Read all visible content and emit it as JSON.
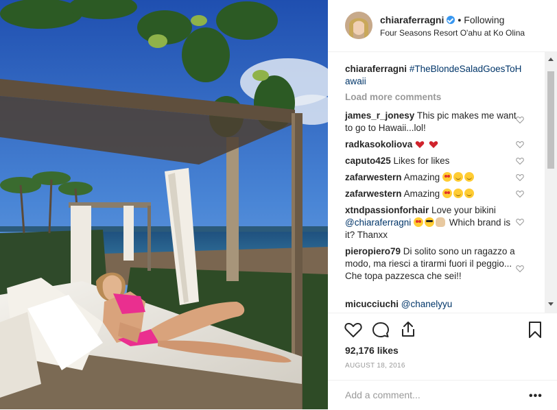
{
  "post": {
    "username": "chiaraferragni",
    "follow_status": "Following",
    "separator": "•",
    "location": "Four Seasons Resort O'ahu at Ko Olina"
  },
  "comments": {
    "caption": {
      "user": "chiaraferragni",
      "text": "#TheBlondeSaladGoesToHawaii"
    },
    "load_more": "Load more comments",
    "items": [
      {
        "user": "james_r_jonesy",
        "text": "This pic makes me want to go to Hawaii...lol!"
      },
      {
        "user": "radkasokoliova",
        "text": ""
      },
      {
        "user": "caputo425",
        "text": "Likes for likes"
      },
      {
        "user": "zafarwestern",
        "text": "Amazing"
      },
      {
        "user": "zafarwestern",
        "text": "Amazing"
      },
      {
        "user": "xtndpassionforhair",
        "text_before": "Love your bikini",
        "mention": "@chiaraferragni",
        "text_after": "Which brand is it? Thanxx"
      },
      {
        "user": "pieropiero79",
        "text": "Di solito sono un ragazzo a modo, ma riesci a tirarmi fuori il peggio... Che topa pazzesca che sei!!"
      },
      {
        "user": "micucciuchi",
        "mention": "@chanelyyu"
      }
    ]
  },
  "engagement": {
    "likes": "92,176 likes",
    "date": "AUGUST 18, 2016"
  },
  "add_comment": {
    "placeholder": "Add a comment...",
    "more": "•••"
  },
  "colors": {
    "link": "#003569",
    "verified": "#3897f0",
    "muted": "#999999",
    "text": "#262626"
  },
  "icons": [
    "verified-badge-icon",
    "heart-icon",
    "comment-icon",
    "share-icon",
    "bookmark-icon",
    "more-options-icon"
  ]
}
